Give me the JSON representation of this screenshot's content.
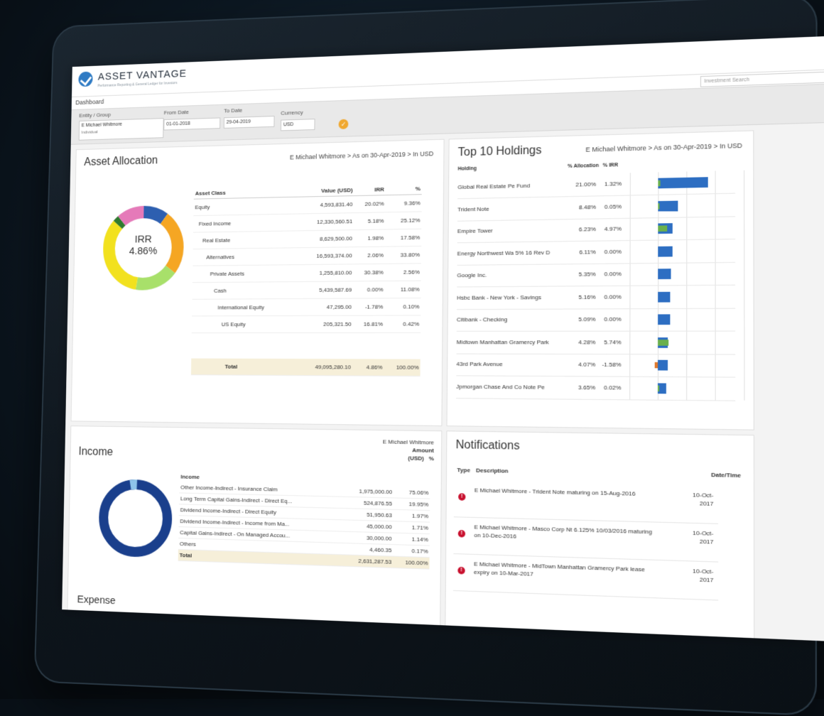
{
  "header": {
    "brand": "ASSET VANTAGE",
    "tagline": "Performance Reporting & General Ledger for Investors",
    "nav_dashboard": "Dashboard",
    "search_placeholder": "Investment Search"
  },
  "filters": {
    "entity_label": "Entity / Group",
    "entity_value": "E Michael Whitmore",
    "entity_sub": "Individual",
    "from_label": "From Date",
    "from_value": "01-01-2018",
    "to_label": "To Date",
    "to_value": "29-04-2019",
    "currency_label": "Currency",
    "currency_value": "USD"
  },
  "colors": {
    "accent": "#f0a830",
    "bar": "#2d6ec2",
    "bar_green": "#6ab04c",
    "alert": "#c8102e"
  },
  "asset_allocation": {
    "title": "Asset Allocation",
    "crumb": "E Michael Whitmore > As on 30-Apr-2019 > In USD",
    "irr_label": "IRR",
    "irr_value": "4.86%",
    "columns": [
      "Asset Class",
      "Value (USD)",
      "IRR",
      "%"
    ],
    "rows": [
      {
        "name": "Equity",
        "value": "4,593,831.40",
        "irr": "20.02%",
        "pct": "9.36%"
      },
      {
        "name": "Fixed Income",
        "value": "12,330,560.51",
        "irr": "5.18%",
        "pct": "25.12%"
      },
      {
        "name": "Real Estate",
        "value": "8,629,500.00",
        "irr": "1.98%",
        "pct": "17.58%"
      },
      {
        "name": "Alternatives",
        "value": "16,593,374.00",
        "irr": "2.06%",
        "pct": "33.80%"
      },
      {
        "name": "Private Assets",
        "value": "1,255,810.00",
        "irr": "30.38%",
        "pct": "2.56%"
      },
      {
        "name": "Cash",
        "value": "5,439,587.69",
        "irr": "0.00%",
        "pct": "11.08%"
      },
      {
        "name": "International Equity",
        "value": "47,295.00",
        "irr": "-1.78%",
        "pct": "0.10%"
      },
      {
        "name": "US Equity",
        "value": "205,321.50",
        "irr": "16.81%",
        "pct": "0.42%"
      }
    ],
    "total": {
      "name": "Total",
      "value": "49,095,280.10",
      "irr": "4.86%",
      "pct": "100.00%"
    }
  },
  "top_holdings": {
    "title": "Top 10 Holdings",
    "crumb": "E Michael Whitmore > As on 30-Apr-2019 > In USD",
    "columns": [
      "Holding",
      "% Allocation",
      "% IRR"
    ],
    "rows": [
      {
        "name": "Global Real Estate Pe Fund",
        "alloc": "21.00%",
        "irr": "1.32%"
      },
      {
        "name": "Trident Note",
        "alloc": "8.48%",
        "irr": "0.05%"
      },
      {
        "name": "Empire Tower",
        "alloc": "6.23%",
        "irr": "4.97%"
      },
      {
        "name": "Energy Northwest Wa 5% 16 Rev D",
        "alloc": "6.11%",
        "irr": "0.00%"
      },
      {
        "name": "Google Inc.",
        "alloc": "5.35%",
        "irr": "0.00%"
      },
      {
        "name": "Hsbc Bank - New York - Savings",
        "alloc": "5.16%",
        "irr": "0.00%"
      },
      {
        "name": "Citibank - Checking",
        "alloc": "5.09%",
        "irr": "0.00%"
      },
      {
        "name": "Midtown Manhattan Gramercy Park",
        "alloc": "4.28%",
        "irr": "5.74%"
      },
      {
        "name": "43rd Park Avenue",
        "alloc": "4.07%",
        "irr": "-1.58%"
      },
      {
        "name": "Jpmorgan Chase And Co Note Pe",
        "alloc": "3.65%",
        "irr": "0.02%"
      }
    ]
  },
  "income": {
    "title": "Income",
    "expense_label": "Expense",
    "entity": "E Michael Whitmore",
    "amount_label": "Amount",
    "usd_label": "(USD)",
    "pct_label": "%",
    "col_income": "Income",
    "rows": [
      {
        "name": "Other Income-Indirect - Insurance Claim",
        "amount": "1,975,000.00",
        "pct": "75.06%"
      },
      {
        "name": "Long Term Capital Gains-Indirect - Direct Eq...",
        "amount": "524,876.55",
        "pct": "19.95%"
      },
      {
        "name": "Dividend Income-Indirect - Direct Equity",
        "amount": "51,950.63",
        "pct": "1.97%"
      },
      {
        "name": "Dividend Income-Indirect - Income from Ma...",
        "amount": "45,000.00",
        "pct": "1.71%"
      },
      {
        "name": "Capital Gains-Indirect - On Managed Accou...",
        "amount": "30,000.00",
        "pct": "1.14%"
      },
      {
        "name": "Others",
        "amount": "4,460.35",
        "pct": "0.17%"
      }
    ],
    "total": {
      "name": "Total",
      "amount": "2,631,287.53",
      "pct": "100.00%"
    }
  },
  "notifications": {
    "title": "Notifications",
    "col_type": "Type",
    "col_desc": "Description",
    "col_date": "Date/Time",
    "rows": [
      {
        "desc": "E Michael Whitmore - Trident Note maturing on 15-Aug-2016",
        "date": "10-Oct-2017"
      },
      {
        "desc": "E Michael Whitmore - Masco Corp Nt 6.125% 10/03/2016 maturing on 10-Dec-2016",
        "date": "10-Oct-2017"
      },
      {
        "desc": "E Michael Whitmore - MidTown Manhattan Gramercy Park lease expiry on 10-Mar-2017",
        "date": "10-Oct-2017"
      }
    ]
  }
}
